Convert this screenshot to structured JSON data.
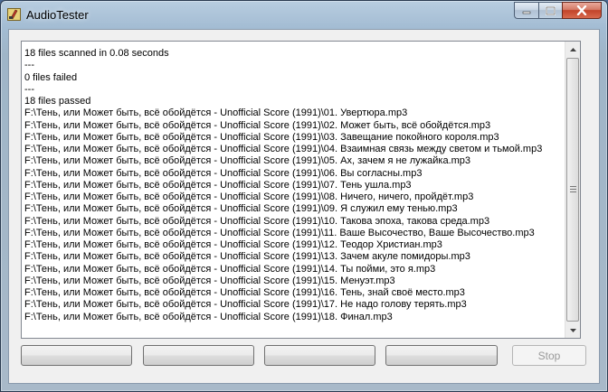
{
  "window": {
    "title": "AudioTester",
    "icon": "app-icon"
  },
  "title_controls": {
    "minimize": "minimize-icon",
    "maximize": "maximize-icon",
    "close": "close-icon"
  },
  "log": {
    "lines": [
      "18 files scanned in 0.08 seconds",
      "---",
      "0 files failed",
      "---",
      "18 files passed",
      "F:\\Тень, или Может быть, всё обойдётся - Unofficial Score (1991)\\01. Увертюра.mp3",
      "F:\\Тень, или Может быть, всё обойдётся - Unofficial Score (1991)\\02. Может быть, всё обойдётся.mp3",
      "F:\\Тень, или Может быть, всё обойдётся - Unofficial Score (1991)\\03. Завещание покойного короля.mp3",
      "F:\\Тень, или Может быть, всё обойдётся - Unofficial Score (1991)\\04. Взаимная связь между светом и тьмой.mp3",
      "F:\\Тень, или Может быть, всё обойдётся - Unofficial Score (1991)\\05. Ах, зачем я не лужайка.mp3",
      "F:\\Тень, или Может быть, всё обойдётся - Unofficial Score (1991)\\06. Вы согласны.mp3",
      "F:\\Тень, или Может быть, всё обойдётся - Unofficial Score (1991)\\07. Тень ушла.mp3",
      "F:\\Тень, или Может быть, всё обойдётся - Unofficial Score (1991)\\08. Ничего, ничего, пройдёт.mp3",
      "F:\\Тень, или Может быть, всё обойдётся - Unofficial Score (1991)\\09. Я служил ему тенью.mp3",
      "F:\\Тень, или Может быть, всё обойдётся - Unofficial Score (1991)\\10. Такова эпоха, такова среда.mp3",
      "F:\\Тень, или Может быть, всё обойдётся - Unofficial Score (1991)\\11. Ваше Высочество, Ваше Высочество.mp3",
      "F:\\Тень, или Может быть, всё обойдётся - Unofficial Score (1991)\\12. Теодор Христиан.mp3",
      "F:\\Тень, или Может быть, всё обойдётся - Unofficial Score (1991)\\13. Зачем акуле помидоры.mp3",
      "F:\\Тень, или Может быть, всё обойдётся - Unofficial Score (1991)\\14. Ты пойми, это я.mp3",
      "F:\\Тень, или Может быть, всё обойдётся - Unofficial Score (1991)\\15. Менуэт.mp3",
      "F:\\Тень, или Может быть, всё обойдётся - Unofficial Score (1991)\\16. Тень, знай своё место.mp3",
      "F:\\Тень, или Может быть, всё обойдётся - Unofficial Score (1991)\\17. Не надо голову терять.mp3",
      "F:\\Тень, или Может быть, всё обойдётся - Unofficial Score (1991)\\18. Финал.mp3"
    ]
  },
  "buttons": {
    "button_1": "",
    "button_2": "",
    "button_3": "",
    "button_4": "",
    "stop": "Stop"
  },
  "colors": {
    "close_button": "#c2432a",
    "log_background": "#ffffff",
    "disabled_text": "#9a9a9a"
  }
}
